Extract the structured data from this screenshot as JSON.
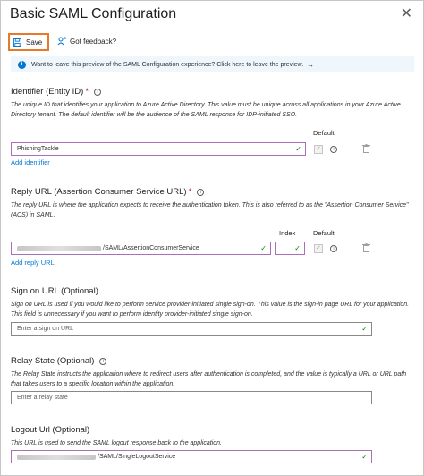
{
  "window": {
    "title": "Basic SAML Configuration",
    "close_icon": "close-icon"
  },
  "toolbar": {
    "save_label": "Save",
    "feedback_label": "Got feedback?"
  },
  "banner": {
    "text": "Want to leave this preview of the SAML Configuration experience? Click here to leave the preview.",
    "arrow": "→"
  },
  "identifier": {
    "title": "Identifier (Entity ID)",
    "required_mark": "*",
    "description": "The unique ID that identifies your application to Azure Active Directory. This value must be unique across all applications in your Azure Active Directory tenant. The default identifier will be the audience of the SAML response for IDP-initiated SSO.",
    "default_header": "Default",
    "value": "PhishingTackle",
    "add_link": "Add identifier"
  },
  "reply_url": {
    "title": "Reply URL (Assertion Consumer Service URL)",
    "required_mark": "*",
    "description": "The reply URL is where the application expects to receive the authentication token. This is also referred to as the \"Assertion Consumer Service\" (ACS) in SAML.",
    "index_header": "Index",
    "default_header": "Default",
    "value_suffix": "/SAML/AssertionConsumerService",
    "add_link": "Add reply URL"
  },
  "sign_on": {
    "title": "Sign on URL (Optional)",
    "description": "Sign on URL is used if you would like to perform service provider-initiated single sign-on. This value is the sign-in page URL for your application. This field is unnecessary if you want to perform identity provider-initiated single sign-on.",
    "placeholder": "Enter a sign on URL"
  },
  "relay_state": {
    "title": "Relay State (Optional)",
    "description": "The Relay State instructs the application where to redirect users after authentication is completed, and the value is typically a URL or URL path that takes users to a specific location within the application.",
    "placeholder": "Enter a relay state"
  },
  "logout": {
    "title": "Logout Url (Optional)",
    "description": "This URL is used to send the SAML logout response back to the application.",
    "value_suffix": "/SAML/SingleLogoutService"
  },
  "colors": {
    "accent": "#0078d4",
    "save_highlight": "#e8782a",
    "valid": "#107c10",
    "required": "#a4262c"
  }
}
